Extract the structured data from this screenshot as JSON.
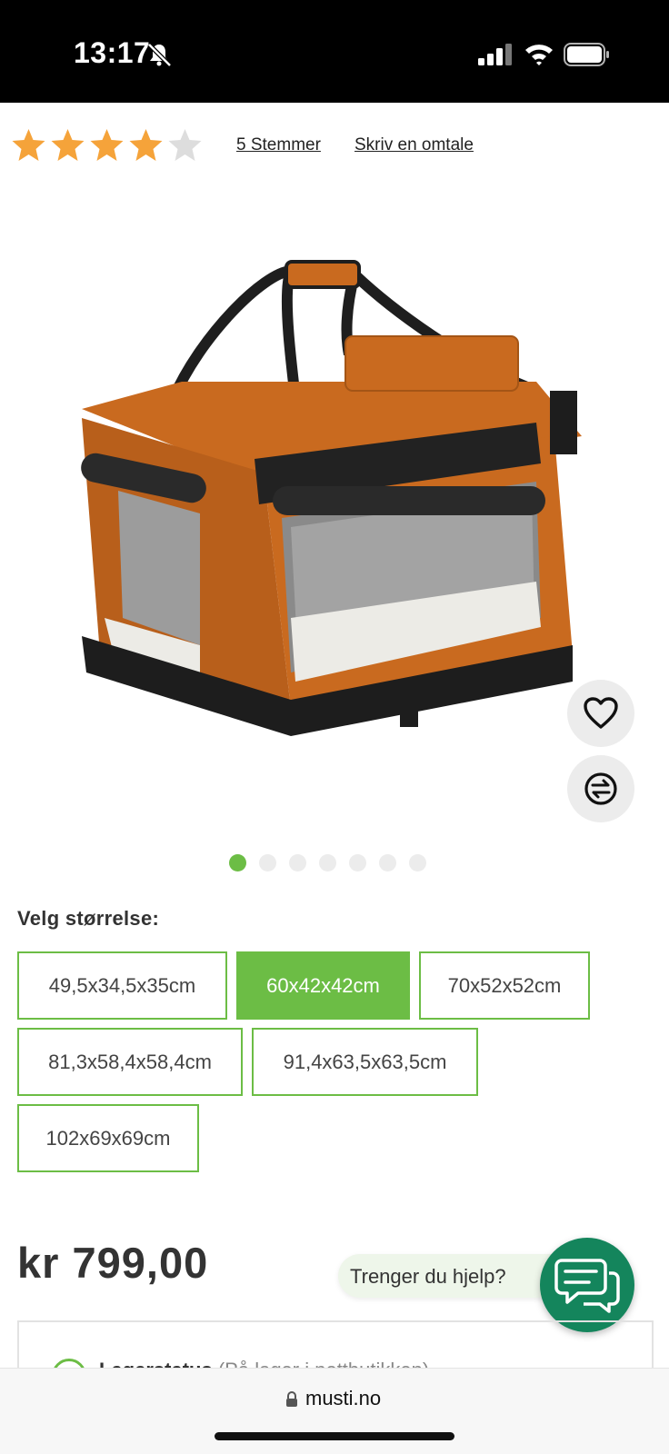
{
  "status_bar": {
    "time": "13:17"
  },
  "rating": {
    "value": 4,
    "max": 5,
    "votes_label": "5 Stemmer",
    "review_label": "Skriv en omtale"
  },
  "carousel": {
    "count": 7,
    "active_index": 0
  },
  "size": {
    "label": "Velg størrelse:",
    "options": [
      "49,5x34,5x35cm",
      "60x42x42cm",
      "70x52x52cm",
      "81,3x58,4x58,4cm",
      "91,4x63,5x63,5cm",
      "102x69x69cm"
    ],
    "selected": "60x42x42cm"
  },
  "price": "kr 799,00",
  "help": {
    "text": "Trenger du hjelp?"
  },
  "stock": {
    "title": "Lagerstatus",
    "detail": "(På lager i nettbutikken)"
  },
  "browser": {
    "url": "musti.no"
  },
  "colors": {
    "accent": "#6cbd45",
    "chat": "#14855c",
    "star": "#f5a33a",
    "star_empty": "#dddddd"
  },
  "icons": [
    "bell-slash-icon",
    "signal-icon",
    "wifi-icon",
    "battery-icon",
    "star-icon",
    "heart-icon",
    "compare-icon",
    "chat-icon",
    "lock-icon"
  ]
}
